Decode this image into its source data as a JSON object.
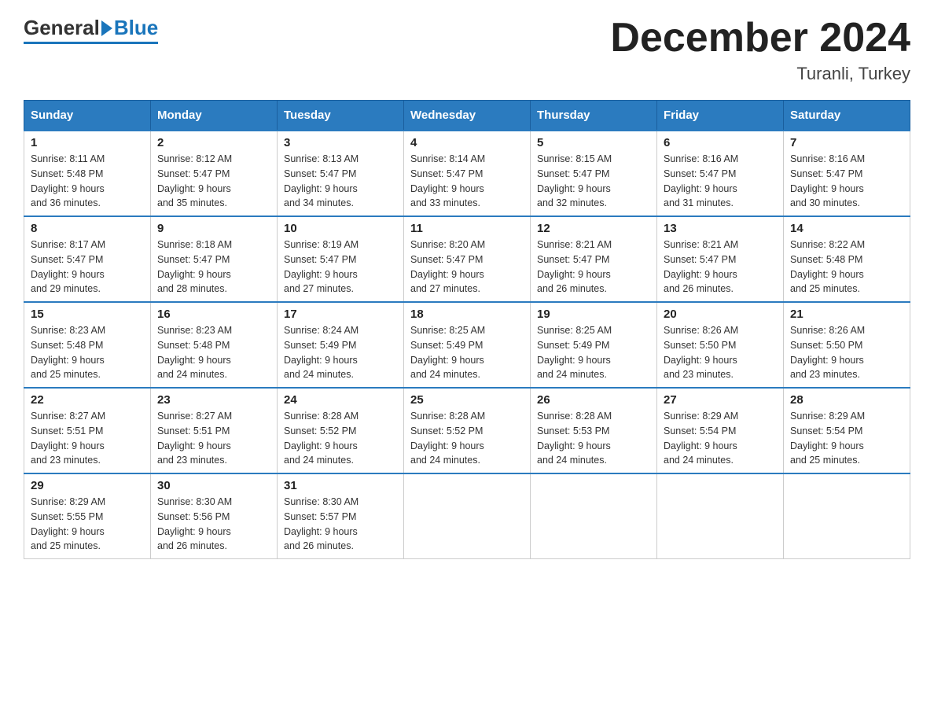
{
  "header": {
    "title": "December 2024",
    "location": "Turanli, Turkey",
    "logo_general": "General",
    "logo_blue": "Blue"
  },
  "columns": [
    "Sunday",
    "Monday",
    "Tuesday",
    "Wednesday",
    "Thursday",
    "Friday",
    "Saturday"
  ],
  "weeks": [
    [
      {
        "day": "1",
        "sunrise": "8:11 AM",
        "sunset": "5:48 PM",
        "daylight": "9 hours and 36 minutes."
      },
      {
        "day": "2",
        "sunrise": "8:12 AM",
        "sunset": "5:47 PM",
        "daylight": "9 hours and 35 minutes."
      },
      {
        "day": "3",
        "sunrise": "8:13 AM",
        "sunset": "5:47 PM",
        "daylight": "9 hours and 34 minutes."
      },
      {
        "day": "4",
        "sunrise": "8:14 AM",
        "sunset": "5:47 PM",
        "daylight": "9 hours and 33 minutes."
      },
      {
        "day": "5",
        "sunrise": "8:15 AM",
        "sunset": "5:47 PM",
        "daylight": "9 hours and 32 minutes."
      },
      {
        "day": "6",
        "sunrise": "8:16 AM",
        "sunset": "5:47 PM",
        "daylight": "9 hours and 31 minutes."
      },
      {
        "day": "7",
        "sunrise": "8:16 AM",
        "sunset": "5:47 PM",
        "daylight": "9 hours and 30 minutes."
      }
    ],
    [
      {
        "day": "8",
        "sunrise": "8:17 AM",
        "sunset": "5:47 PM",
        "daylight": "9 hours and 29 minutes."
      },
      {
        "day": "9",
        "sunrise": "8:18 AM",
        "sunset": "5:47 PM",
        "daylight": "9 hours and 28 minutes."
      },
      {
        "day": "10",
        "sunrise": "8:19 AM",
        "sunset": "5:47 PM",
        "daylight": "9 hours and 27 minutes."
      },
      {
        "day": "11",
        "sunrise": "8:20 AM",
        "sunset": "5:47 PM",
        "daylight": "9 hours and 27 minutes."
      },
      {
        "day": "12",
        "sunrise": "8:21 AM",
        "sunset": "5:47 PM",
        "daylight": "9 hours and 26 minutes."
      },
      {
        "day": "13",
        "sunrise": "8:21 AM",
        "sunset": "5:47 PM",
        "daylight": "9 hours and 26 minutes."
      },
      {
        "day": "14",
        "sunrise": "8:22 AM",
        "sunset": "5:48 PM",
        "daylight": "9 hours and 25 minutes."
      }
    ],
    [
      {
        "day": "15",
        "sunrise": "8:23 AM",
        "sunset": "5:48 PM",
        "daylight": "9 hours and 25 minutes."
      },
      {
        "day": "16",
        "sunrise": "8:23 AM",
        "sunset": "5:48 PM",
        "daylight": "9 hours and 24 minutes."
      },
      {
        "day": "17",
        "sunrise": "8:24 AM",
        "sunset": "5:49 PM",
        "daylight": "9 hours and 24 minutes."
      },
      {
        "day": "18",
        "sunrise": "8:25 AM",
        "sunset": "5:49 PM",
        "daylight": "9 hours and 24 minutes."
      },
      {
        "day": "19",
        "sunrise": "8:25 AM",
        "sunset": "5:49 PM",
        "daylight": "9 hours and 24 minutes."
      },
      {
        "day": "20",
        "sunrise": "8:26 AM",
        "sunset": "5:50 PM",
        "daylight": "9 hours and 23 minutes."
      },
      {
        "day": "21",
        "sunrise": "8:26 AM",
        "sunset": "5:50 PM",
        "daylight": "9 hours and 23 minutes."
      }
    ],
    [
      {
        "day": "22",
        "sunrise": "8:27 AM",
        "sunset": "5:51 PM",
        "daylight": "9 hours and 23 minutes."
      },
      {
        "day": "23",
        "sunrise": "8:27 AM",
        "sunset": "5:51 PM",
        "daylight": "9 hours and 23 minutes."
      },
      {
        "day": "24",
        "sunrise": "8:28 AM",
        "sunset": "5:52 PM",
        "daylight": "9 hours and 24 minutes."
      },
      {
        "day": "25",
        "sunrise": "8:28 AM",
        "sunset": "5:52 PM",
        "daylight": "9 hours and 24 minutes."
      },
      {
        "day": "26",
        "sunrise": "8:28 AM",
        "sunset": "5:53 PM",
        "daylight": "9 hours and 24 minutes."
      },
      {
        "day": "27",
        "sunrise": "8:29 AM",
        "sunset": "5:54 PM",
        "daylight": "9 hours and 24 minutes."
      },
      {
        "day": "28",
        "sunrise": "8:29 AM",
        "sunset": "5:54 PM",
        "daylight": "9 hours and 25 minutes."
      }
    ],
    [
      {
        "day": "29",
        "sunrise": "8:29 AM",
        "sunset": "5:55 PM",
        "daylight": "9 hours and 25 minutes."
      },
      {
        "day": "30",
        "sunrise": "8:30 AM",
        "sunset": "5:56 PM",
        "daylight": "9 hours and 26 minutes."
      },
      {
        "day": "31",
        "sunrise": "8:30 AM",
        "sunset": "5:57 PM",
        "daylight": "9 hours and 26 minutes."
      },
      null,
      null,
      null,
      null
    ]
  ]
}
